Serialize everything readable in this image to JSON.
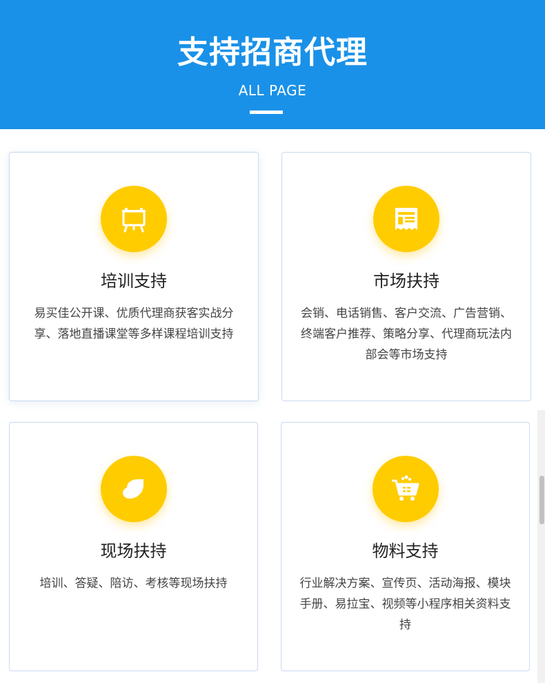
{
  "header": {
    "title": "支持招商代理",
    "subtitle": "ALL PAGE",
    "background": "#1a91e8"
  },
  "accent_color": "#ffcc00",
  "cards": [
    {
      "icon": "easel-presentation-icon",
      "title": "培训支持",
      "description": "易买佳公开课、优质代理商获客实战分享、落地直播课堂等多样课程培训支持"
    },
    {
      "icon": "newspaper-icon",
      "title": "市场扶持",
      "description": "会销、电话销售、客户交流、广告营销、终端客户推荐、策略分享、代理商玩法内部会等市场支持"
    },
    {
      "icon": "leaf-shape-icon",
      "title": "现场扶持",
      "description": "培训、答疑、陪访、考核等现场扶持"
    },
    {
      "icon": "shopping-cart-icon",
      "title": "物料支持",
      "description": "行业解决方案、宣传页、活动海报、模块手册、易拉宝、视频等小程序相关资料支持"
    }
  ]
}
